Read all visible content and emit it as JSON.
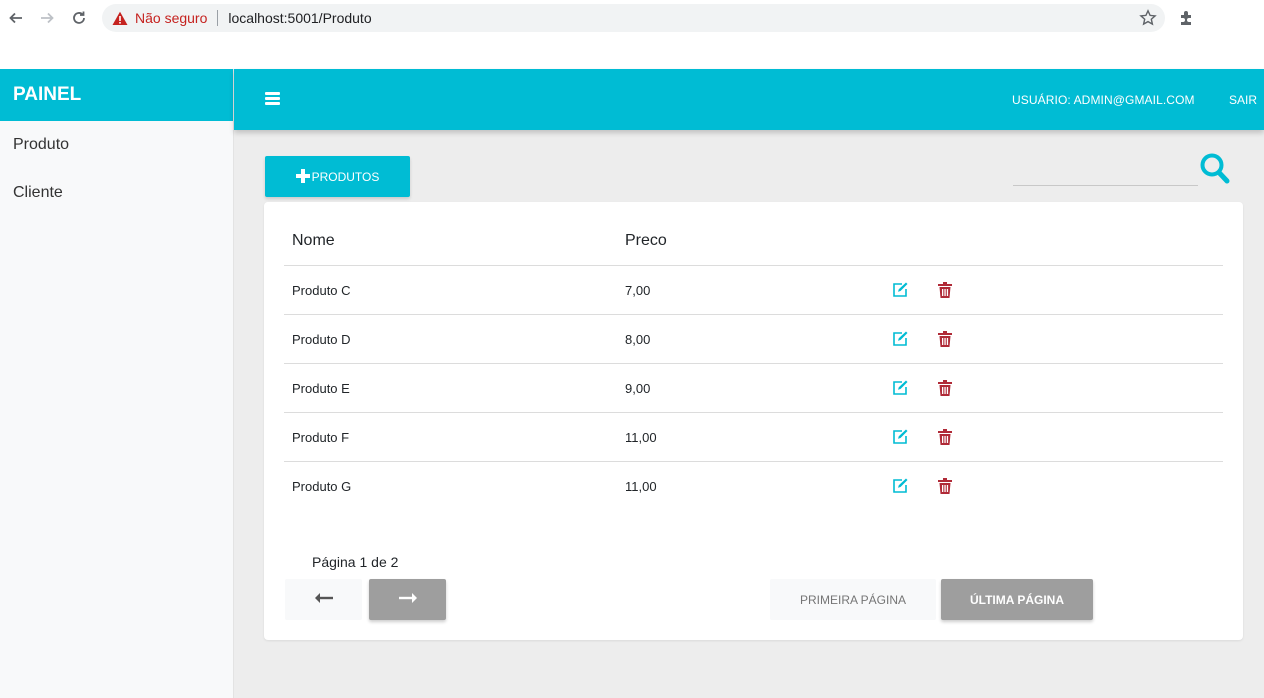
{
  "browser": {
    "security_label": "Não seguro",
    "url": "localhost:5001/Produto"
  },
  "sidebar": {
    "brand": "PAINEL",
    "items": [
      {
        "label": "Produto"
      },
      {
        "label": "Cliente"
      }
    ]
  },
  "header": {
    "user_label": "USUÁRIO: ADMIN@GMAIL.COM",
    "logout_label": "SAIR"
  },
  "toolbar": {
    "add_label": "PRODUTOS",
    "search_placeholder": ""
  },
  "table": {
    "columns": [
      "Nome",
      "Preco"
    ],
    "rows": [
      {
        "nome": "Produto C",
        "preco": "7,00"
      },
      {
        "nome": "Produto D",
        "preco": "8,00"
      },
      {
        "nome": "Produto E",
        "preco": "9,00"
      },
      {
        "nome": "Produto F",
        "preco": "11,00"
      },
      {
        "nome": "Produto G",
        "preco": "11,00"
      }
    ]
  },
  "pagination": {
    "info": "Página 1 de 2",
    "first_label": "PRIMEIRA PÁGINA",
    "last_label": "ÚLTIMA PÁGINA"
  },
  "colors": {
    "accent": "#00bcd4",
    "delete": "#b02a37",
    "pager_active": "#9e9e9e"
  },
  "icons": {
    "menu": "hamburger-icon",
    "add": "plus-icon",
    "search": "search-icon",
    "edit": "edit-icon",
    "delete": "trash-icon",
    "prev": "arrow-left-icon",
    "next": "arrow-right-icon"
  }
}
